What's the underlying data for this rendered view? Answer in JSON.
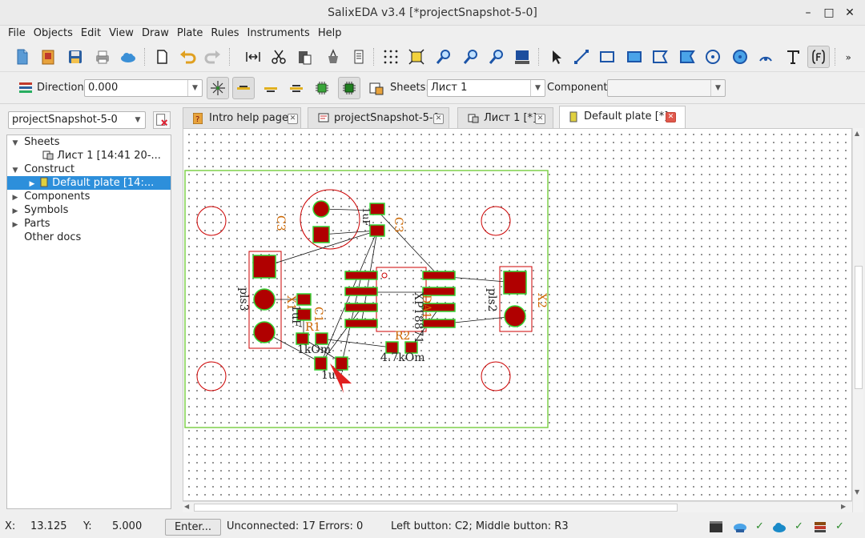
{
  "window": {
    "title": "SalixEDA v3.4 [*projectSnapshot-5-0]",
    "minimize": "–",
    "maximize": "□",
    "close": "✕"
  },
  "menu": [
    "File",
    "Objects",
    "Edit",
    "View",
    "Draw",
    "Plate",
    "Rules",
    "Instruments",
    "Help"
  ],
  "toolbar": {
    "direction_label": "Direction:",
    "direction_value": "0.000",
    "sheets_label": "Sheets:",
    "sheets_value": "Лист 1",
    "component_label": "Component:",
    "component_value": ""
  },
  "project": {
    "selector_value": "projectSnapshot-5-0",
    "tree": [
      {
        "label": "Sheets",
        "level": 0,
        "expander": "▼"
      },
      {
        "label": "Лист 1 [14:41 20-...",
        "level": 1,
        "expander": ""
      },
      {
        "label": "Construct",
        "level": 0,
        "expander": "▼"
      },
      {
        "label": "Default plate [14:...",
        "level": 1,
        "expander": "▶",
        "selected": true
      },
      {
        "label": "Components",
        "level": 0,
        "expander": "▶"
      },
      {
        "label": "Symbols",
        "level": 0,
        "expander": "▶"
      },
      {
        "label": "Parts",
        "level": 0,
        "expander": "▶"
      },
      {
        "label": "Other docs",
        "level": 0,
        "expander": ""
      }
    ]
  },
  "tabs": [
    {
      "label": "Intro help page"
    },
    {
      "label": "projectSnapshot-5-0"
    },
    {
      "label": "Лист 1 [*]"
    },
    {
      "label": "Default plate [*]",
      "active": true
    }
  ],
  "pcb": {
    "component_labels": {
      "c3": "C3",
      "c3_value": "1uF",
      "c3_silk": "C3",
      "x1": "X1",
      "pls3": "pls3",
      "c1": "C1",
      "c1_value": "1uF",
      "r1": "R1",
      "r1_value": "1kOm",
      "c2_value": "1uF",
      "da1": "DA1",
      "da1_part": "XPT8871",
      "r2": "R2",
      "r2_value": "4.7kOm",
      "pls2": "pls2",
      "x2": "X2"
    },
    "colors": {
      "outline": "#7fd04a",
      "pad": "#b00000",
      "pad_border": "#33d433",
      "silk": "#cc0000",
      "text": "#cc6600"
    }
  },
  "status": {
    "x_label": "X:",
    "x_value": "13.125",
    "y_label": "Y:",
    "y_value": "5.000",
    "enter": "Enter...",
    "unconnected": "Unconnected: 17  Errors: 0",
    "buttons": "Left button: C2;   Middle button: R3",
    "checks": [
      "✓",
      "✓",
      "✓",
      "✓"
    ]
  }
}
